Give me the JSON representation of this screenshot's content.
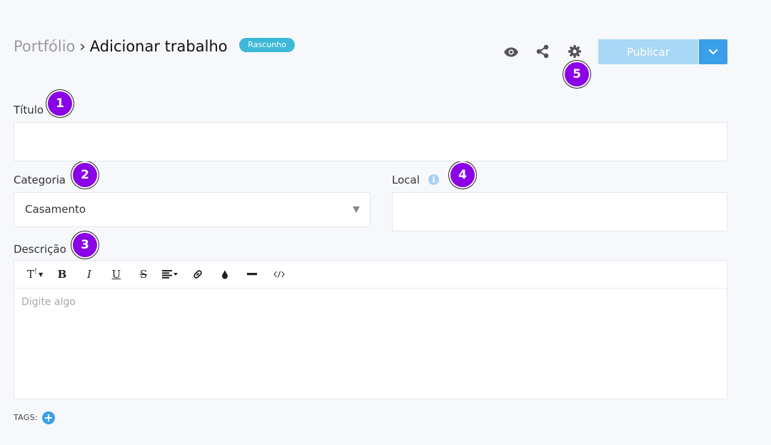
{
  "header": {
    "breadcrumb_parent": "Portfólio",
    "breadcrumb_separator": "›",
    "page_title": "Adicionar trabalho",
    "status_badge": "Rascunho",
    "publish_label": "Publicar",
    "icons": [
      "eye-icon",
      "share-icon",
      "gear-icon",
      "chevron-down-icon"
    ]
  },
  "markers": [
    "1",
    "2",
    "3",
    "4",
    "5"
  ],
  "form": {
    "title_label": "Título",
    "title_value": "",
    "category_label": "Categoria",
    "category_value": "Casamento",
    "location_label": "Local",
    "location_value": "",
    "description_label": "Descrição",
    "description_placeholder": "Digite algo",
    "tags_label": "TAGS:"
  },
  "toolbar": {
    "text_style": "T",
    "bold": "B",
    "italic": "I",
    "underline": "U",
    "strike": "S"
  },
  "colors": {
    "background": "#f6f8fc",
    "accent": "#3a9fea",
    "publish_disabled": "#a9d7f6",
    "badge": "#3cb9d6",
    "marker": "#8b00e6"
  }
}
